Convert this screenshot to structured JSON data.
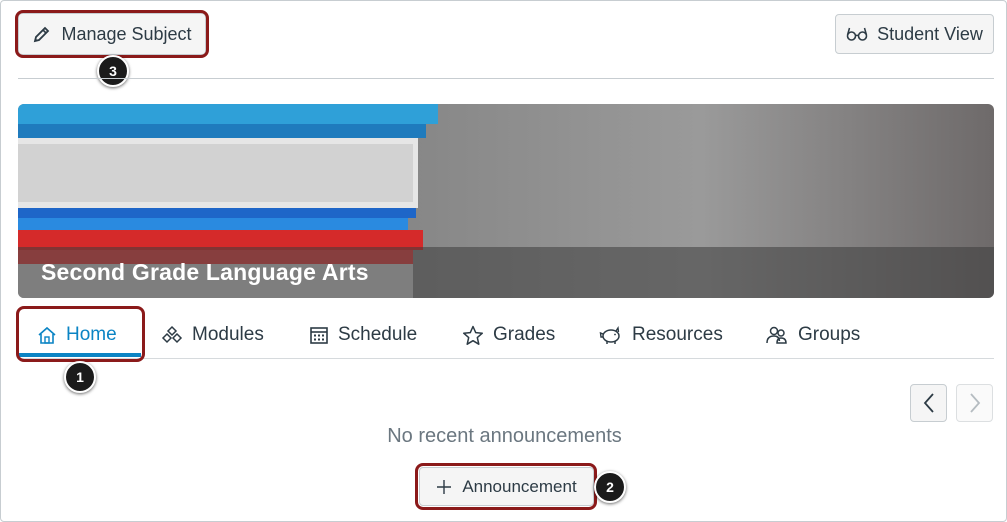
{
  "toolbar": {
    "manage_label": "Manage Subject",
    "student_view_label": "Student View"
  },
  "hero": {
    "title": "Second Grade Language Arts"
  },
  "tabs": [
    {
      "label": "Home",
      "icon": "home-icon",
      "active": true
    },
    {
      "label": "Modules",
      "icon": "modules-icon",
      "active": false
    },
    {
      "label": "Schedule",
      "icon": "calendar-icon",
      "active": false
    },
    {
      "label": "Grades",
      "icon": "star-icon",
      "active": false
    },
    {
      "label": "Resources",
      "icon": "piggy-bank-icon",
      "active": false
    },
    {
      "label": "Groups",
      "icon": "groups-icon",
      "active": false
    }
  ],
  "announcements": {
    "empty_message": "No recent announcements",
    "add_label": "Announcement"
  },
  "callouts": {
    "one": "1",
    "two": "2",
    "three": "3"
  },
  "colors": {
    "accent": "#0b84c4",
    "callout_border": "#8b1a1a",
    "text": "#2d3b45"
  }
}
